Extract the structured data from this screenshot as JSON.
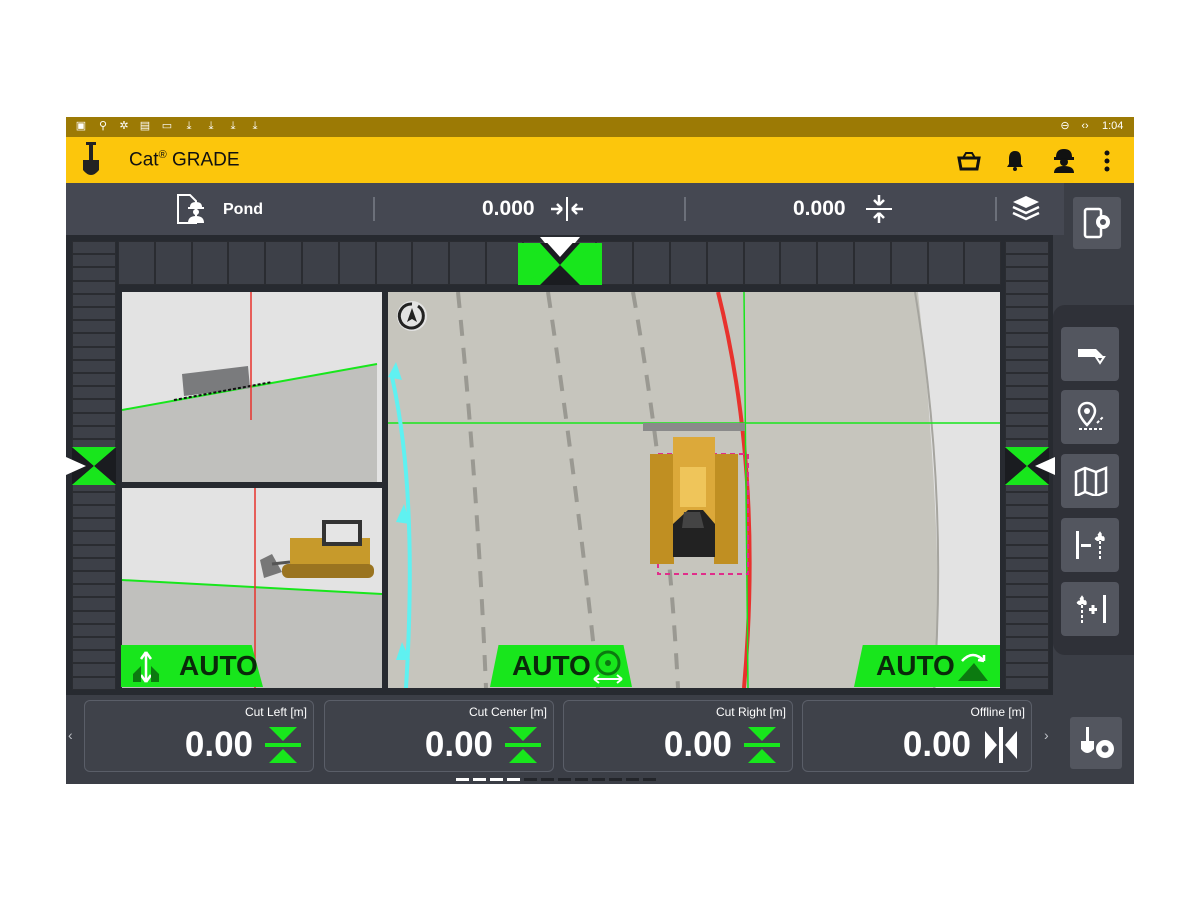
{
  "status_bar": {
    "time": "1:04"
  },
  "app_bar": {
    "title_prefix": "Cat",
    "title_reg": "®",
    "title_suffix": " GRADE",
    "icons": [
      "basket-icon",
      "bell-icon",
      "operator-icon",
      "more-vert-icon"
    ]
  },
  "info_bar": {
    "design_name": "Pond",
    "cross_slope_value": "0.000",
    "main_fall_value": "0.000"
  },
  "auto_modes": {
    "left_label": "AUTO",
    "center_label": "AUTO",
    "right_label": "AUTO"
  },
  "cards": [
    {
      "label": "Cut Left",
      "unit": "[m]",
      "value": "0.00",
      "icon": "cut-fill-icon"
    },
    {
      "label": "Cut Center",
      "unit": "[m]",
      "value": "0.00",
      "icon": "cut-fill-icon"
    },
    {
      "label": "Cut Right",
      "unit": "[m]",
      "value": "0.00",
      "icon": "cut-fill-icon"
    },
    {
      "label": "Offline",
      "unit": "[m]",
      "value": "0.00",
      "icon": "offline-icon"
    }
  ],
  "side_buttons": [
    "blade-view-icon",
    "location-icon",
    "map-icon",
    "offset-left-icon",
    "offset-right-icon"
  ],
  "colors": {
    "brand_yellow": "#fcc60c",
    "status_gold": "#9c7a05",
    "on_grade_green": "#18e61c",
    "panel_dark": "#3b3e46",
    "path_cyan": "#5ff1f1",
    "boundary_red": "#e8322d"
  },
  "pagination": {
    "page_count": 12,
    "active_pages": 4
  }
}
